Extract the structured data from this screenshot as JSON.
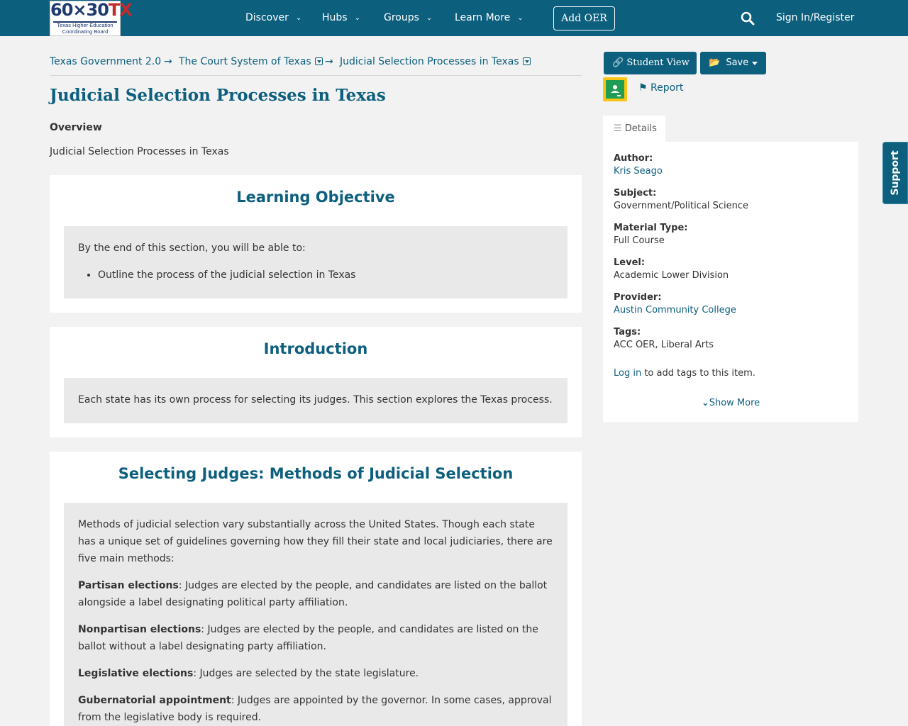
{
  "header": {
    "logo_main": "60×30",
    "logo_tx": "TX",
    "logo_sub": "Texas Higher Education Coordinating Board",
    "nav": [
      "Discover",
      "Hubs",
      "Groups",
      "Learn More"
    ],
    "add_oer": "Add OER",
    "signin": "Sign In/Register"
  },
  "breadcrumb": {
    "items": [
      "Texas Government 2.0",
      "The Court System of Texas",
      "Judicial Selection Processes in Texas"
    ],
    "separator": "→"
  },
  "page": {
    "title": "Judicial Selection Processes in Texas",
    "overview_label": "Overview",
    "overview_text": "Judicial Selection Processes in Texas"
  },
  "sections": {
    "objective": {
      "heading": "Learning Objective",
      "intro": "By the end of this section, you will be able to:",
      "bullet": "Outline the process of the judicial selection in Texas"
    },
    "introduction": {
      "heading": "Introduction",
      "text": "Each state has its own process for selecting its judges. This section explores the Texas process."
    },
    "selecting": {
      "heading": "Selecting Judges: Methods of Judicial Selection",
      "intro": "Methods of judicial selection vary substantially across the United States. Though each state has a unique set of guidelines governing how they fill their state and local judiciaries, there are five main methods:",
      "methods": [
        {
          "term": "Partisan elections",
          "desc": ": Judges are elected by the people, and candidates are listed on the ballot alongside a label designating political party affiliation."
        },
        {
          "term": "Nonpartisan elections",
          "desc": ": Judges are elected by the people, and candidates are listed on the ballot without a label designating party affiliation."
        },
        {
          "term": "Legislative elections",
          "desc": ": Judges are selected by the state legislature."
        },
        {
          "term": "Gubernatorial appointment",
          "desc": ": Judges are appointed by the governor. In some cases, approval from the legislative body is required."
        }
      ]
    }
  },
  "sidebar": {
    "student_view": "Student View",
    "save": "Save",
    "report": "Report",
    "details_tab": "Details",
    "fields": {
      "author_label": "Author:",
      "author": "Kris Seago",
      "subject_label": "Subject:",
      "subject": "Government/Political Science",
      "material_label": "Material Type:",
      "material": "Full Course",
      "level_label": "Level:",
      "level": "Academic Lower Division",
      "provider_label": "Provider:",
      "provider": "Austin Community College",
      "tags_label": "Tags:",
      "tags": "ACC OER, Liberal Arts"
    },
    "login_link": "Log in",
    "login_suffix": " to add tags to this item.",
    "show_more": "Show More"
  },
  "support": "Support",
  "colors": {
    "brand": "#0d5f7e",
    "background": "#f1f2f1",
    "panel": "#e9e9e9"
  }
}
